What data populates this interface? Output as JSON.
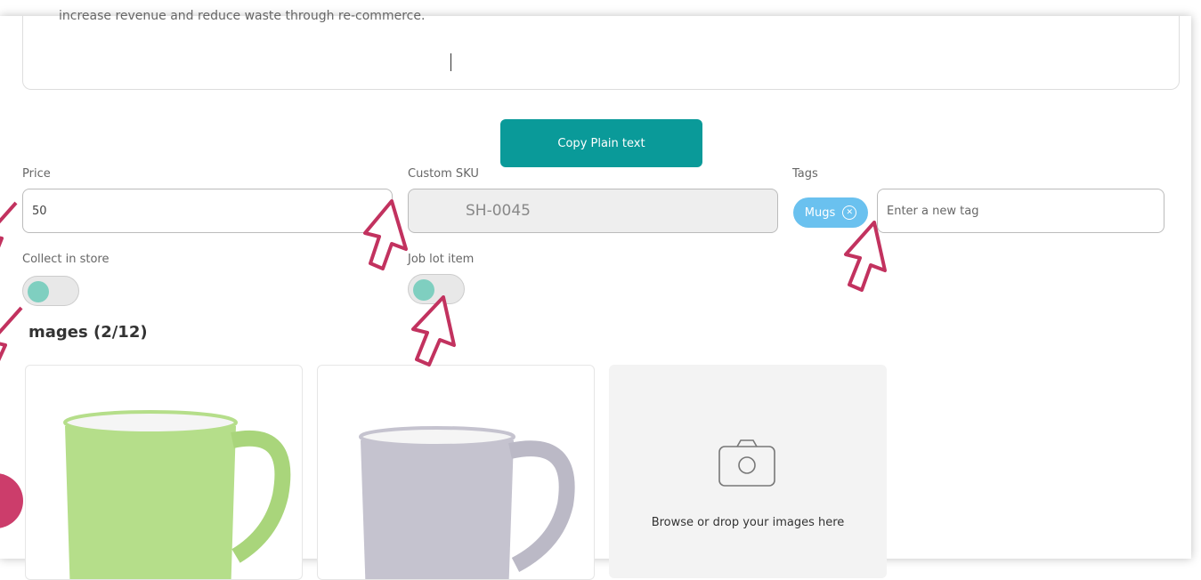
{
  "textarea": {
    "clipped_text": "increase revenue and reduce waste through re-commerce."
  },
  "copy_button": {
    "label": "Copy Plain text"
  },
  "price": {
    "label": "Price",
    "value": "50"
  },
  "sku": {
    "label": "Custom SKU",
    "value": "SH-0045"
  },
  "tags": {
    "label": "Tags",
    "chips": [
      {
        "label": "Mugs"
      }
    ],
    "placeholder": "Enter a new tag"
  },
  "collect_in_store": {
    "label": "Collect in store"
  },
  "job_lot": {
    "label": "Job lot item"
  },
  "images": {
    "title": "mages (2/12)",
    "upload_text": "Browse or drop your images here"
  },
  "colors": {
    "accent": "#0a9a99",
    "tag_chip": "#6ac1ef",
    "pointer": "#c2325f",
    "knob": "#7fcfc0",
    "mug_green": "#b5de8a",
    "mug_grey": "#c5c3cf"
  }
}
